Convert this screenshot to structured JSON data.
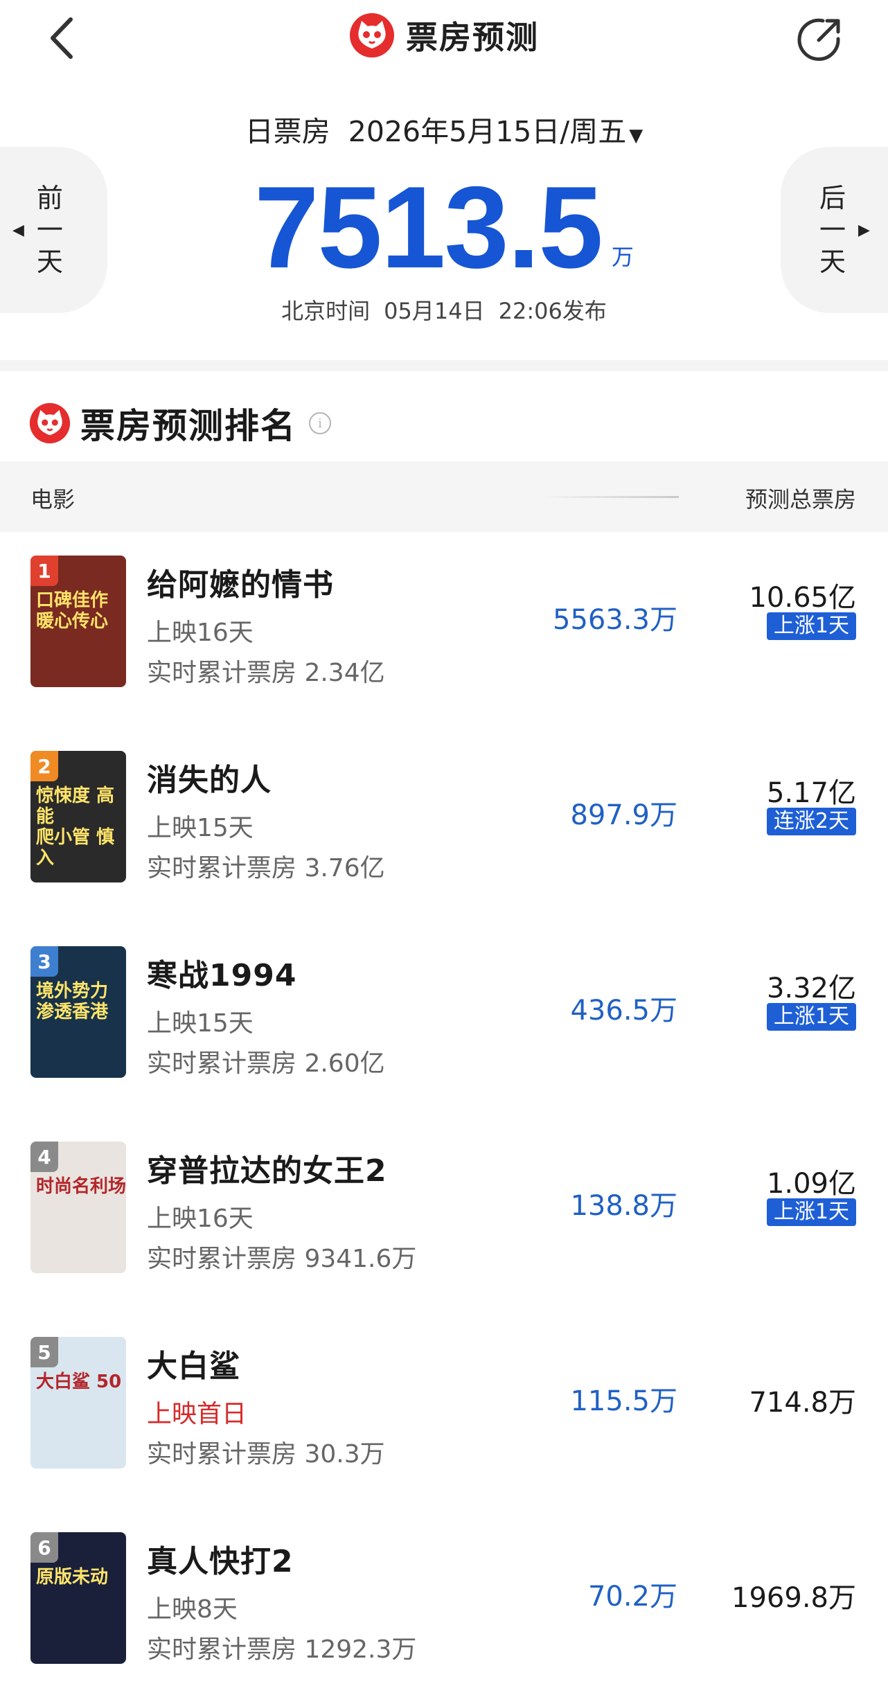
{
  "header": {
    "title": "票房预测"
  },
  "date_row": {
    "label": "日票房",
    "date": "2026年5月15日/周五",
    "caret": "▼"
  },
  "nav": {
    "prev": [
      "前",
      "一",
      "天"
    ],
    "next": [
      "后",
      "一",
      "天"
    ]
  },
  "total": {
    "value": "7513.5",
    "unit": "万"
  },
  "publish": {
    "tz": "北京时间",
    "date": "05月14日",
    "time": "22:06发布"
  },
  "section": {
    "title": "票房预测排名"
  },
  "table_head": {
    "movie": "电影",
    "total": "预测总票房"
  },
  "movies": [
    {
      "rank": "1",
      "name": "给阿嬷的情书",
      "days": "上映16天",
      "cum": "实时累计票房 2.34亿",
      "forecast": "5563.3万",
      "total": "10.65亿",
      "trend": "上涨1天",
      "poster_text": "口碑佳作\n暖心传心",
      "poster_color": "#7a2a20",
      "badge_color": "#e0402e"
    },
    {
      "rank": "2",
      "name": "消失的人",
      "days": "上映15天",
      "cum": "实时累计票房 3.76亿",
      "forecast": "897.9万",
      "total": "5.17亿",
      "trend": "连涨2天",
      "poster_text": "惊悚度 高能\n爬小管 慎入",
      "poster_color": "#2a2a2a",
      "badge_color": "#f08a24"
    },
    {
      "rank": "3",
      "name": "寒战1994",
      "days": "上映15天",
      "cum": "实时累计票房 2.60亿",
      "forecast": "436.5万",
      "total": "3.32亿",
      "trend": "上涨1天",
      "poster_text": "境外势力\n渗透香港",
      "poster_color": "#17324a",
      "badge_color": "#3e7fd0"
    },
    {
      "rank": "4",
      "name": "穿普拉达的女王2",
      "days": "上映16天",
      "cum": "实时累计票房 9341.6万",
      "forecast": "138.8万",
      "total": "1.09亿",
      "trend": "上涨1天",
      "poster_text": "时尚名利场",
      "poster_color": "#e9e4df",
      "badge_color": "#8a8a8a"
    },
    {
      "rank": "5",
      "name": "大白鲨",
      "days": "上映首日",
      "cum": "实时累计票房 30.3万",
      "forecast": "115.5万",
      "total": "714.8万",
      "trend": "",
      "poster_text": "大白鲨 50",
      "poster_color": "#d9e6ef",
      "badge_color": "#8a8a8a"
    },
    {
      "rank": "6",
      "name": "真人快打2",
      "days": "上映8天",
      "cum": "实时累计票房 1292.3万",
      "forecast": "70.2万",
      "total": "1969.8万",
      "trend": "",
      "poster_text": "原版未动",
      "poster_color": "#1a1f3a",
      "badge_color": "#8a8a8a"
    }
  ]
}
